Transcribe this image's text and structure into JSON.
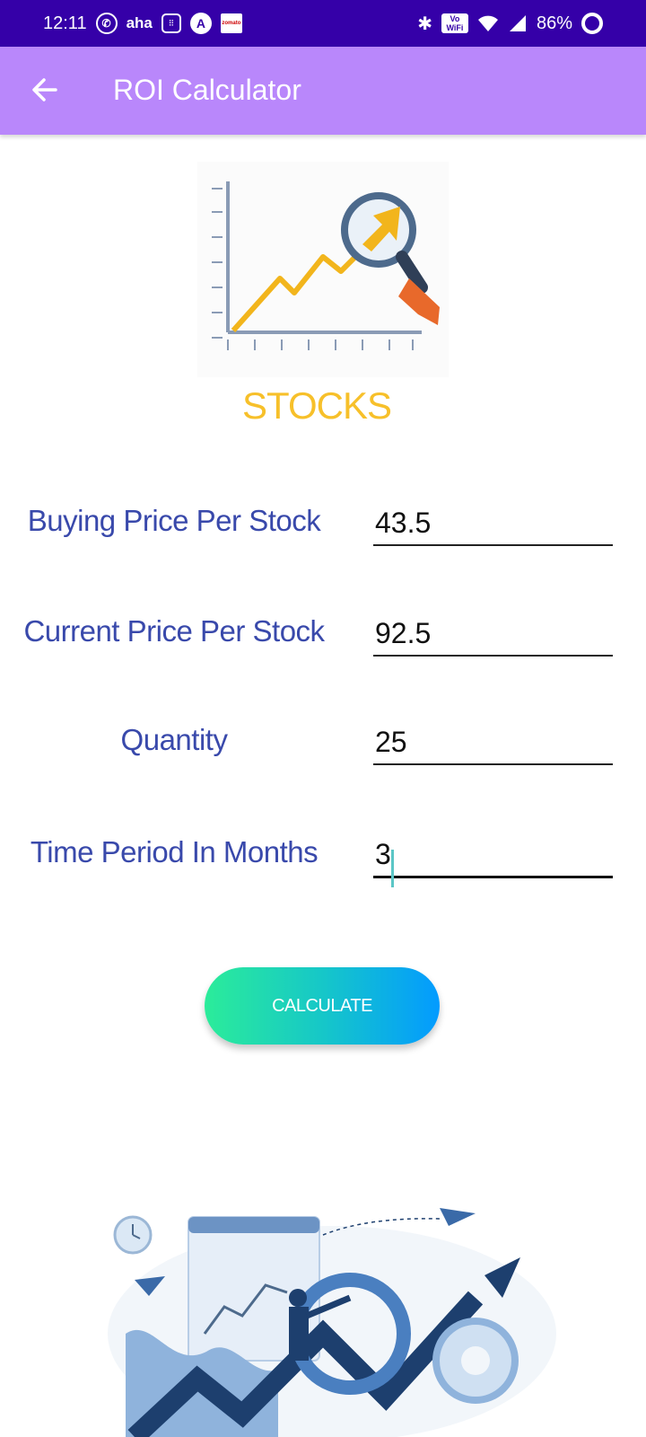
{
  "status_bar": {
    "time": "12:11",
    "battery": "86%",
    "left_icons": [
      "whatsapp-icon",
      "aha-icon",
      "calculator-icon",
      "a-app-icon",
      "zomato-icon"
    ],
    "right_icons": [
      "bluetooth-icon",
      "vowifi-icon",
      "wifi-icon",
      "signal-icon",
      "battery-icon"
    ],
    "aha_label": "aha",
    "zomato_label": "zomato",
    "vowifi_label_top": "Vo",
    "vowifi_label_bottom": "WiFi"
  },
  "app_bar": {
    "title": "ROI Calculator",
    "color": "#b987fb"
  },
  "hero": {
    "title": "STOCKS",
    "title_color": "#f7c02a"
  },
  "form": {
    "buying_price": {
      "label": "Buying Price Per Stock",
      "value": "43.5"
    },
    "current_price": {
      "label": "Current Price Per Stock",
      "value": "92.5"
    },
    "quantity": {
      "label": "Quantity",
      "value": "25"
    },
    "time_period": {
      "label": "Time Period In Months",
      "value": "3"
    },
    "label_color": "#3949ab"
  },
  "calculate_button": {
    "label": "CALCULATE"
  }
}
